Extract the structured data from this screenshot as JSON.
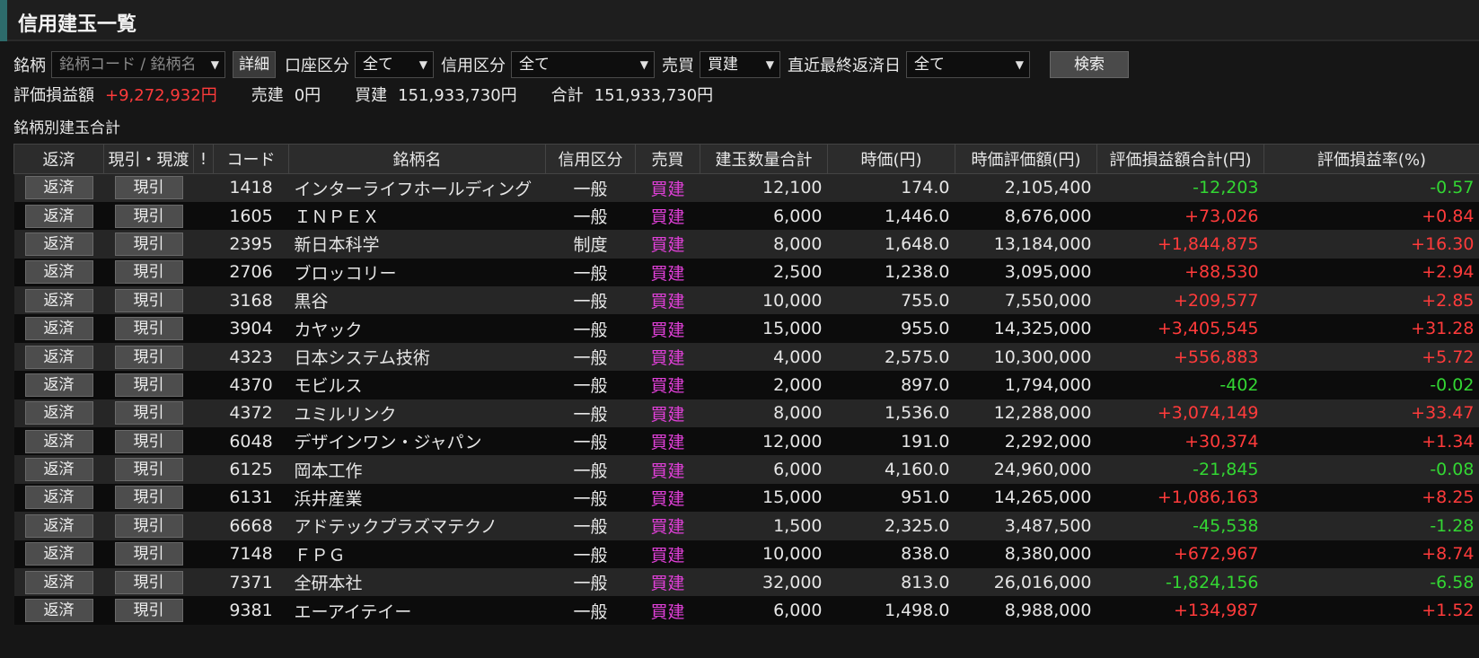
{
  "window": {
    "title": "信用建玉一覧"
  },
  "filters": {
    "meigara_label": "銘柄",
    "meigara_placeholder": "銘柄コード / 銘柄名",
    "detail_button": "詳細",
    "account_label": "口座区分",
    "account_value": "全て",
    "credit_label": "信用区分",
    "credit_value": "全て",
    "trade_label": "売買",
    "trade_value": "買建",
    "due_label": "直近最終返済日",
    "due_value": "全て",
    "search_button": "検索"
  },
  "summary": {
    "pl_label": "評価損益額",
    "pl_value": "+9,272,932円",
    "sell_label": "売建",
    "sell_value": "0円",
    "buy_label": "買建",
    "buy_value": "151,933,730円",
    "total_label": "合計",
    "total_value": "151,933,730円"
  },
  "section_label": "銘柄別建玉合計",
  "table": {
    "headers": [
      "返済",
      "現引・現渡",
      "!",
      "コード",
      "銘柄名",
      "信用区分",
      "売買",
      "建玉数量合計",
      "時価(円)",
      "時価評価額(円)",
      "評価損益額合計(円)",
      "評価損益率(%)"
    ],
    "repay_button": "返済",
    "genbiki_button": "現引",
    "rows": [
      {
        "code": "1418",
        "name": "インターライフホールディング",
        "kubun": "一般",
        "side": "買建",
        "qty": "12,100",
        "price": "174.0",
        "value": "2,105,400",
        "pl": "-12,203",
        "rate": "-0.57",
        "sign": "neg"
      },
      {
        "code": "1605",
        "name": "ＩＮＰＥＸ",
        "kubun": "一般",
        "side": "買建",
        "qty": "6,000",
        "price": "1,446.0",
        "value": "8,676,000",
        "pl": "+73,026",
        "rate": "+0.84",
        "sign": "pos"
      },
      {
        "code": "2395",
        "name": "新日本科学",
        "kubun": "制度",
        "side": "買建",
        "qty": "8,000",
        "price": "1,648.0",
        "value": "13,184,000",
        "pl": "+1,844,875",
        "rate": "+16.30",
        "sign": "pos"
      },
      {
        "code": "2706",
        "name": "ブロッコリー",
        "kubun": "一般",
        "side": "買建",
        "qty": "2,500",
        "price": "1,238.0",
        "value": "3,095,000",
        "pl": "+88,530",
        "rate": "+2.94",
        "sign": "pos"
      },
      {
        "code": "3168",
        "name": "黒谷",
        "kubun": "一般",
        "side": "買建",
        "qty": "10,000",
        "price": "755.0",
        "value": "7,550,000",
        "pl": "+209,577",
        "rate": "+2.85",
        "sign": "pos"
      },
      {
        "code": "3904",
        "name": "カヤック",
        "kubun": "一般",
        "side": "買建",
        "qty": "15,000",
        "price": "955.0",
        "value": "14,325,000",
        "pl": "+3,405,545",
        "rate": "+31.28",
        "sign": "pos"
      },
      {
        "code": "4323",
        "name": "日本システム技術",
        "kubun": "一般",
        "side": "買建",
        "qty": "4,000",
        "price": "2,575.0",
        "value": "10,300,000",
        "pl": "+556,883",
        "rate": "+5.72",
        "sign": "pos"
      },
      {
        "code": "4370",
        "name": "モビルス",
        "kubun": "一般",
        "side": "買建",
        "qty": "2,000",
        "price": "897.0",
        "value": "1,794,000",
        "pl": "-402",
        "rate": "-0.02",
        "sign": "neg"
      },
      {
        "code": "4372",
        "name": "ユミルリンク",
        "kubun": "一般",
        "side": "買建",
        "qty": "8,000",
        "price": "1,536.0",
        "value": "12,288,000",
        "pl": "+3,074,149",
        "rate": "+33.47",
        "sign": "pos"
      },
      {
        "code": "6048",
        "name": "デザインワン・ジャパン",
        "kubun": "一般",
        "side": "買建",
        "qty": "12,000",
        "price": "191.0",
        "value": "2,292,000",
        "pl": "+30,374",
        "rate": "+1.34",
        "sign": "pos"
      },
      {
        "code": "6125",
        "name": "岡本工作",
        "kubun": "一般",
        "side": "買建",
        "qty": "6,000",
        "price": "4,160.0",
        "value": "24,960,000",
        "pl": "-21,845",
        "rate": "-0.08",
        "sign": "neg"
      },
      {
        "code": "6131",
        "name": "浜井産業",
        "kubun": "一般",
        "side": "買建",
        "qty": "15,000",
        "price": "951.0",
        "value": "14,265,000",
        "pl": "+1,086,163",
        "rate": "+8.25",
        "sign": "pos"
      },
      {
        "code": "6668",
        "name": "アドテックプラズマテクノ",
        "kubun": "一般",
        "side": "買建",
        "qty": "1,500",
        "price": "2,325.0",
        "value": "3,487,500",
        "pl": "-45,538",
        "rate": "-1.28",
        "sign": "neg"
      },
      {
        "code": "7148",
        "name": "ＦＰＧ",
        "kubun": "一般",
        "side": "買建",
        "qty": "10,000",
        "price": "838.0",
        "value": "8,380,000",
        "pl": "+672,967",
        "rate": "+8.74",
        "sign": "pos"
      },
      {
        "code": "7371",
        "name": "全研本社",
        "kubun": "一般",
        "side": "買建",
        "qty": "32,000",
        "price": "813.0",
        "value": "26,016,000",
        "pl": "-1,824,156",
        "rate": "-6.58",
        "sign": "neg"
      },
      {
        "code": "9381",
        "name": "エーアイテイー",
        "kubun": "一般",
        "side": "買建",
        "qty": "6,000",
        "price": "1,498.0",
        "value": "8,988,000",
        "pl": "+134,987",
        "rate": "+1.52",
        "sign": "pos"
      }
    ]
  },
  "colors": {
    "positive": "#ff3b3b",
    "negative": "#33d633",
    "buy": "#e040d8",
    "accent": "#2d6b6b"
  }
}
